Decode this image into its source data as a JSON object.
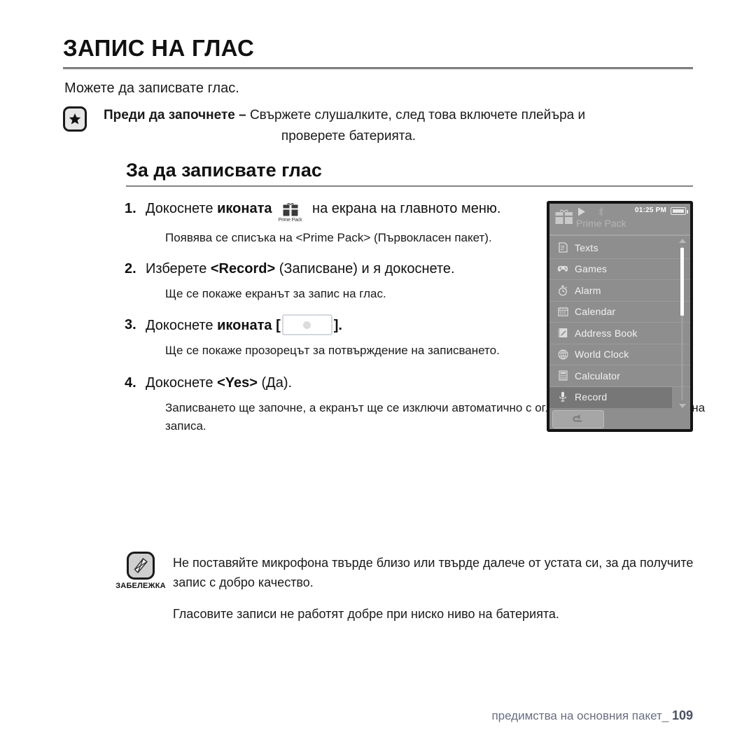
{
  "document": {
    "chapter_title": "ЗАПИС НА ГЛАС",
    "intro": "Можете да записвате глас.",
    "callout": {
      "icon": "star-icon",
      "lead": "Преди да започнете – ",
      "line1": "Свържете слушалките, след това включете плейъра и",
      "line2": "проверете батерията."
    },
    "section_heading": "За да записвате глас",
    "steps": [
      {
        "num": "1.",
        "main_before": "Докоснете ",
        "main_bold": "иконата",
        "main_after": " на екрана на главното меню.",
        "inline_icon_label": "Prime Pack",
        "sub": "Появява се списъка на <Prime Pack> (Първокласен пакет)."
      },
      {
        "num": "2.",
        "main_before": "Изберете ",
        "main_bold": "<Record>",
        "main_after": " (Записване) и я докоснете.",
        "sub": "Ще се покаже екранът за запис на глас."
      },
      {
        "num": "3.",
        "main_before": "Докоснете ",
        "main_bold": "иконата",
        "bracket_open": "[",
        "bracket_close": "].",
        "sub": "Ще се покаже прозорецът за потвърждение на записването."
      },
      {
        "num": "4.",
        "main_before": "Докоснете ",
        "main_bold": "<Yes>",
        "main_after": " (Да).",
        "sub": "Записването ще започне, а екранът ще се изключи автоматично с оглед на по-добро качество на записа."
      }
    ],
    "note": {
      "icon": "note-pencil-icon",
      "label": "ЗАБЕЛЕЖКА",
      "line1": "Не поставяйте микрофона твърде близо или твърде далече от устата си, за да получите запис с добро качество.",
      "line2": "Гласовите записи не работят добре при ниско ниво на батерията."
    },
    "footer": {
      "text": "предимства на основния пакет_",
      "page_number": "109"
    }
  },
  "device": {
    "status_bar": {
      "app_icon": "gift-box-icon",
      "play_icon": "play-icon",
      "bluetooth_icon": "bluetooth-icon",
      "time": "01:25 PM",
      "battery_icon": "battery-full-icon"
    },
    "breadcrumb": "Prime Pack",
    "menu_items": [
      {
        "label": "Texts",
        "icon": "document-icon",
        "selected": false
      },
      {
        "label": "Games",
        "icon": "gamepad-icon",
        "selected": false
      },
      {
        "label": "Alarm",
        "icon": "stopwatch-icon",
        "selected": false
      },
      {
        "label": "Calendar",
        "icon": "calendar-icon",
        "selected": false
      },
      {
        "label": "Address Book",
        "icon": "addressbook-icon",
        "selected": false
      },
      {
        "label": "World Clock",
        "icon": "globe-icon",
        "selected": false
      },
      {
        "label": "Calculator",
        "icon": "calculator-icon",
        "selected": false
      },
      {
        "label": "Record",
        "icon": "microphone-icon",
        "selected": true
      }
    ],
    "scrollbar": {
      "up_arrow": "chevron-up-icon",
      "down_arrow": "chevron-down-icon"
    },
    "back_button_icon": "back-arrow-icon",
    "colors": {
      "screen_bg": "#8e8e8e",
      "status_bg": "#919191",
      "selected_row": "#777777",
      "text": "#f2f2f2",
      "breadcrumb_text": "#b5b5b5"
    }
  }
}
